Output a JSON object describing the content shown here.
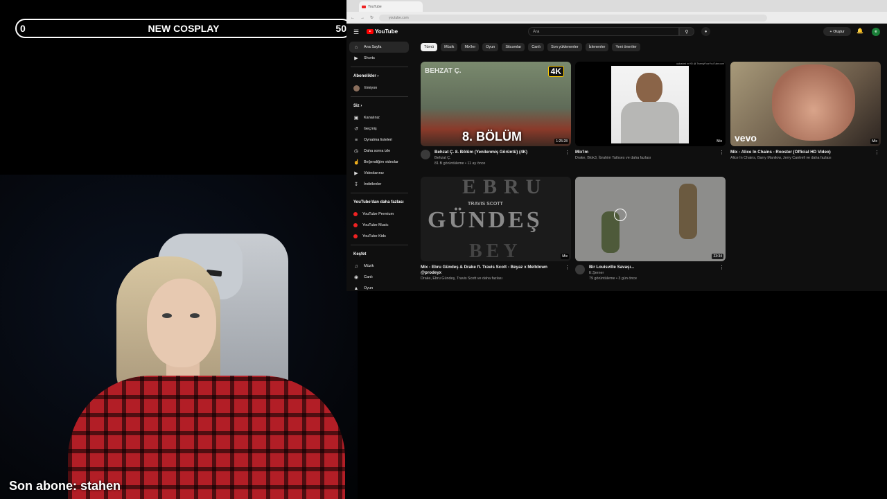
{
  "overlay": {
    "goal_start": "0",
    "goal_title": "NEW COSPLAY",
    "goal_end": "50",
    "last_sub": "Son abone: stahen"
  },
  "browser": {
    "tab_title": "YouTube",
    "url": "youtube.com"
  },
  "youtube": {
    "logo": "YouTube",
    "search_placeholder": "Ara",
    "create_label": "Oluştur",
    "avatar_letter": "e",
    "sidebar": {
      "top": [
        {
          "label": "Ana Sayfa",
          "icon": "home-icon"
        },
        {
          "label": "Shorts",
          "icon": "shorts-icon"
        }
      ],
      "subs_header": "Abonelikler",
      "subs": [
        {
          "label": "Emiyon"
        }
      ],
      "you_header": "Siz",
      "you": [
        {
          "label": "Kanalınız",
          "icon": "channel-icon"
        },
        {
          "label": "Geçmiş",
          "icon": "history-icon"
        },
        {
          "label": "Oynatma listeleri",
          "icon": "playlist-icon"
        },
        {
          "label": "Daha sonra izle",
          "icon": "clock-icon"
        },
        {
          "label": "Beğendiğim videolar",
          "icon": "thumbs-up-icon"
        },
        {
          "label": "Videolarınız",
          "icon": "video-icon"
        },
        {
          "label": "İndirilenler",
          "icon": "download-icon"
        }
      ],
      "more_header": "YouTube'dan daha fazlası",
      "more": [
        {
          "label": "YouTube Premium"
        },
        {
          "label": "YouTube Music"
        },
        {
          "label": "YouTube Kids"
        }
      ],
      "explore_header": "Keşfet",
      "explore": [
        {
          "label": "Müzik",
          "icon": "music-icon"
        },
        {
          "label": "Canlı",
          "icon": "live-icon"
        },
        {
          "label": "Oyun",
          "icon": "gamepad-icon"
        }
      ]
    },
    "chips": [
      "Tümü",
      "Müzik",
      "Mix'ler",
      "Oyun",
      "Sitcomlar",
      "Canlı",
      "Son yüklenenler",
      "İzlenenler",
      "Yeni öneriler"
    ],
    "videos": [
      {
        "title": "Behzat Ç. 8. Bölüm (Yenilenmiş Görüntü) (4K)",
        "channel": "Behzat Ç.",
        "stats": "81 B görüntüleme • 11 ay önce",
        "duration": "1:25:28",
        "thumb_text": "8. BÖLÜM",
        "badge": "4K",
        "logo": "BEHZAT Ç."
      },
      {
        "title": "Mix'im",
        "channel": "Drake, Blok3, İbrahim Tatlıses ve daha fazlası",
        "stats": "",
        "duration": "Mix",
        "thumb_text": "uploaded in HD @ TwentyFourYouTube.com"
      },
      {
        "title": "Mix - Alice In Chains - Rooster (Official HD Video)",
        "channel": "Alice In Chains, Barry Manilow, Jerry Cantrell ve daha fazlası",
        "stats": "",
        "duration": "Mix",
        "thumb_text": "vevo"
      },
      {
        "title": "Mix - Ebru Gündeş & Drake ft. Travis Scott - Beyaz x Meltdown @prodeyx",
        "channel": "Drake, Ebru Gündeş, Travis Scott ve daha fazlası",
        "stats": "",
        "duration": "Mix",
        "thumb_text": "GÜNDEŞ",
        "thumb_top": "EBRU",
        "thumb_mid": "TRAVIS SCOTT",
        "thumb_bottom": "BEY"
      },
      {
        "title": "Bir Louisville Savaşı...",
        "channel": "E.Şerner",
        "stats": "79 görüntüleme • 3 gün önce",
        "duration": "23:34"
      }
    ]
  },
  "colors": {
    "yt_red": "#ff0000",
    "shirt_red": "#b21e26",
    "yt_bg": "#0f0f0f"
  }
}
